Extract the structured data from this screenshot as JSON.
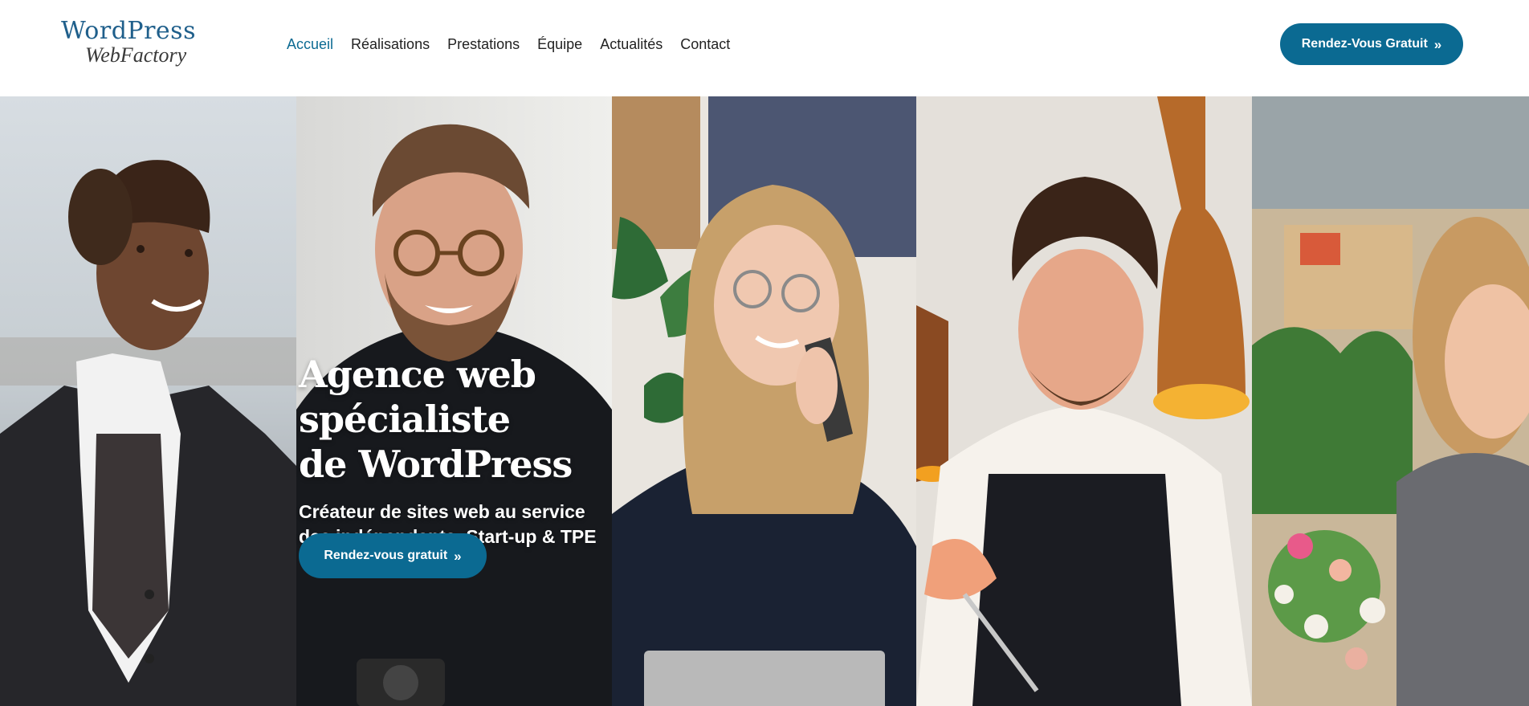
{
  "logo": {
    "word": "WordPress",
    "sub": "WebFactory"
  },
  "nav": [
    {
      "label": "Accueil"
    },
    {
      "label": "Réalisations"
    },
    {
      "label": "Prestations"
    },
    {
      "label": "Équipe"
    },
    {
      "label": "Actualités"
    },
    {
      "label": "Contact"
    }
  ],
  "header_cta": {
    "label": "Rendez-Vous Gratuit",
    "icon": "double-chevron-right-icon"
  },
  "hero": {
    "title_line1": "Agence web spécialiste",
    "title_line2": "de WordPress",
    "subtitle_line1": "Créateur de sites web au service",
    "subtitle_line2": "des indépendants, Start-up & TPE",
    "cta_label": "Rendez-vous gratuit",
    "cta_icon": "double-chevron-right-icon"
  },
  "colors": {
    "brand": "#0b6a92",
    "nav_active": "#0b6a92",
    "text": "#222222"
  }
}
